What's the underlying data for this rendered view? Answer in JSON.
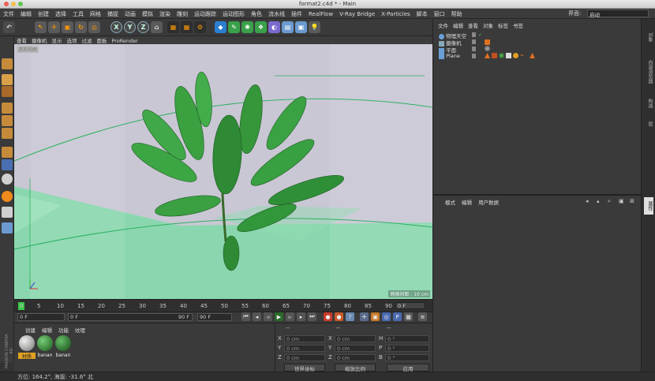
{
  "window": {
    "title": "format2.c4d * - Main"
  },
  "menubar": {
    "items": [
      "文件",
      "编辑",
      "创建",
      "选择",
      "工具",
      "网格",
      "捕捉",
      "动画",
      "模拟",
      "渲染",
      "雕刻",
      "运动跟踪",
      "运动图形",
      "角色",
      "流水线",
      "插件",
      "RealFlow",
      "V-Ray Bridge",
      "X-Particles",
      "脚本",
      "窗口",
      "帮助"
    ],
    "interface_label": "界面:",
    "interface_value": "启动"
  },
  "toolbar": {
    "axis_x": "X",
    "axis_y": "Y",
    "axis_z": "Z"
  },
  "viewport": {
    "menu": [
      "查看",
      "摄像机",
      "显示",
      "选项",
      "过滤",
      "面板",
      "ProRender"
    ],
    "label": "透视视图",
    "grid_info": "网格间距 : 10 cm"
  },
  "timeline": {
    "ticks": [
      "0",
      "5",
      "10",
      "15",
      "20",
      "25",
      "30",
      "35",
      "40",
      "45",
      "50",
      "55",
      "60",
      "65",
      "70",
      "75",
      "80",
      "85",
      "90"
    ],
    "current_frame": "0 F",
    "start_field": "0 F",
    "range_start": "0 F",
    "range_end": "90 F",
    "end_field": "90 F"
  },
  "materials": {
    "menu": [
      "创建",
      "编辑",
      "功能",
      "纹理"
    ],
    "items": [
      {
        "name": "材质",
        "color": "#b0b0b0"
      },
      {
        "name": "banan",
        "color": "#3a8a3a"
      },
      {
        "name": "banan",
        "color": "#2f7a2f"
      }
    ],
    "brand": "MAXON CINEMA 4D"
  },
  "coordinates": {
    "headers": [
      "--",
      "--",
      "--"
    ],
    "rows": [
      {
        "a": "X",
        "av": "0 cm",
        "b": "X",
        "bv": "0 cm",
        "c": "H",
        "cv": "0 °"
      },
      {
        "a": "Y",
        "av": "0 cm",
        "b": "Y",
        "bv": "0 cm",
        "c": "P",
        "cv": "0 °"
      },
      {
        "a": "Z",
        "av": "0 cm",
        "b": "Z",
        "bv": "0 cm",
        "c": "B",
        "cv": "0 °"
      }
    ],
    "world_btn": "世界坐标",
    "scale_btn": "缩放比例",
    "apply_btn": "应用"
  },
  "status": {
    "text": "方位: 164.2°, 海拔: -31.6° 北"
  },
  "objects": {
    "menu": [
      "文件",
      "编辑",
      "查看",
      "对象",
      "标签",
      "书签"
    ],
    "rows": [
      {
        "name": "物理天空",
        "icon_color": "#6aa0d8"
      },
      {
        "name": "摄像机",
        "icon_color": "#8ab"
      },
      {
        "name": "平面",
        "icon_color": "#6aa0d8"
      },
      {
        "name": "Plane",
        "icon_color": "#6aa0d8"
      }
    ]
  },
  "attributes": {
    "menu": [
      "模式",
      "编辑",
      "用户数据"
    ]
  },
  "right_tabs": [
    "对象",
    "内容浏览器",
    "构造",
    "层",
    "属性"
  ]
}
